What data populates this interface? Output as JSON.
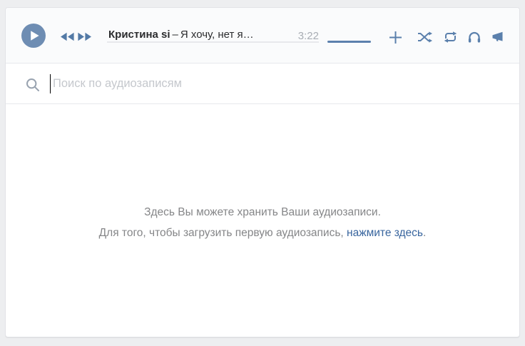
{
  "player": {
    "artist": "Кристина si",
    "separator": "–",
    "track": "Я хочу, нет я…",
    "duration": "3:22",
    "action_icons": [
      "add",
      "shuffle",
      "repeat",
      "headphones",
      "broadcast"
    ]
  },
  "search": {
    "placeholder": "Поиск по аудиозаписям"
  },
  "empty_state": {
    "line1": "Здесь Вы можете хранить Ваши аудиозаписи.",
    "line2_prefix": "Для того, чтобы загрузить первую аудиозапись, ",
    "link_text": "нажмите здесь",
    "line2_suffix": "."
  },
  "colors": {
    "page_background": "#edeef0",
    "player_bar_background": "#fafbfc",
    "divider": "#e7e8ec",
    "play_button": "#6e8db3",
    "icon_blue": "#5b80ac",
    "volume_bar": "#5c80ad",
    "progress_track": "#e7e8ec",
    "title_text": "#2b2c2e",
    "duration_text": "#a8adb4",
    "placeholder_text": "#c5c8cd",
    "message_text": "#858688",
    "link_text": "#38659e"
  }
}
